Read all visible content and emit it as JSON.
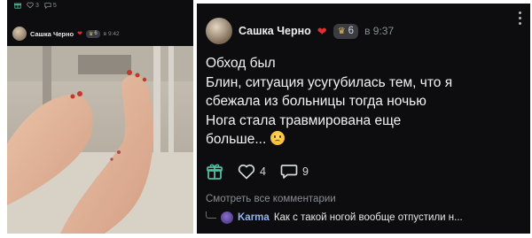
{
  "left_post": {
    "top_bar": {
      "count_a": "3",
      "count_b": "5"
    },
    "author": "Сашка Черно",
    "heart": "❤",
    "badge_count": "6",
    "time": "в 9:42"
  },
  "right_post": {
    "author": "Сашка Черно",
    "heart": "❤",
    "badge_count": "6",
    "time": "в 9:37",
    "text_lines": [
      "Обход был",
      "Блин, ситуация усугубилась тем, что я",
      "сбежала из больницы тогда ночью",
      "Нога стала травмирована еще",
      "больше..."
    ],
    "likes": "4",
    "comments": "9",
    "view_comments": "Смотреть все комментарии",
    "comment": {
      "author": "Karma",
      "text": "Как с такой ногой вообще отпустили н..."
    }
  },
  "colors": {
    "background": "#0d0d0f",
    "heart": "#e0302f",
    "gift_icon": "#4fbf9f",
    "comment_author": "#8fb4ee"
  },
  "icons": [
    "gift-icon",
    "heart-outline-icon",
    "comment-icon",
    "more-vertical-icon",
    "crown-icon",
    "sad-emoji-icon"
  ]
}
